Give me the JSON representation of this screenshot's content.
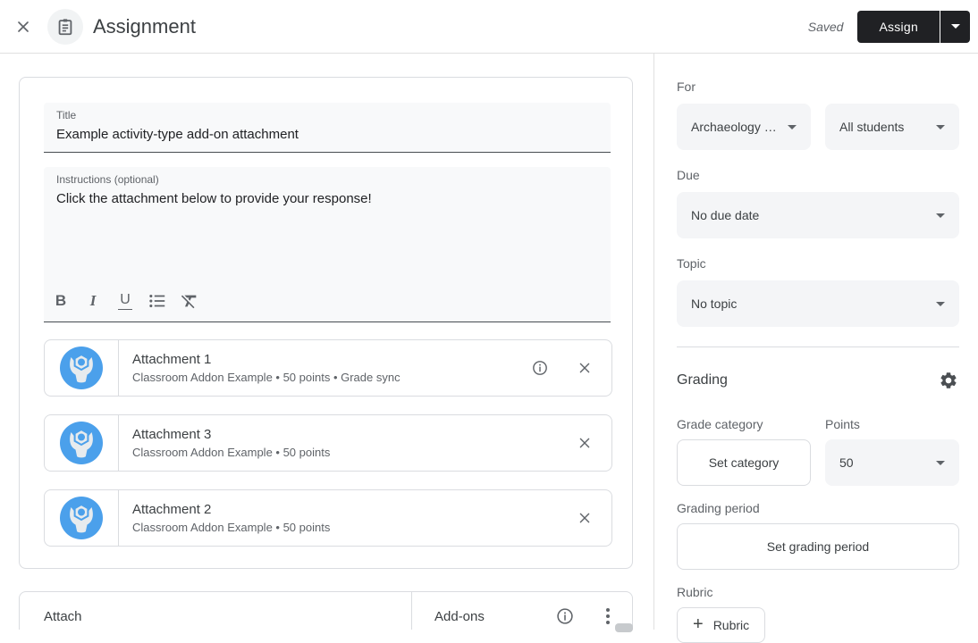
{
  "header": {
    "title": "Assignment",
    "saved_status": "Saved",
    "assign_label": "Assign"
  },
  "editor": {
    "title_label": "Title",
    "title_value": "Example activity-type add-on attachment",
    "instructions_label": "Instructions (optional)",
    "instructions_value": "Click the attachment below to provide your response!",
    "toolbar_icons": [
      "bold",
      "italic",
      "underline",
      "bulleted-list",
      "clear-formatting"
    ],
    "bold_glyph": "B",
    "italic_glyph": "I",
    "underline_glyph": "U"
  },
  "attachments": [
    {
      "title": "Attachment 1",
      "subtitle": "Classroom Addon Example • 50 points • Grade sync"
    },
    {
      "title": "Attachment 3",
      "subtitle": "Classroom Addon Example • 50 points"
    },
    {
      "title": "Attachment 2",
      "subtitle": "Classroom Addon Example • 50 points"
    }
  ],
  "attach_bar": {
    "attach_label": "Attach",
    "addons_label": "Add-ons"
  },
  "sidebar": {
    "for_label": "For",
    "course_value": "Archaeology …",
    "audience_value": "All students",
    "due_label": "Due",
    "due_value": "No due date",
    "topic_label": "Topic",
    "topic_value": "No topic",
    "grading_title": "Grading",
    "grade_category_label": "Grade category",
    "set_category_label": "Set category",
    "points_label": "Points",
    "points_value": "50",
    "grading_period_label": "Grading period",
    "set_grading_period_label": "Set grading period",
    "rubric_label": "Rubric",
    "rubric_button_label": "Rubric"
  },
  "colors": {
    "accent_blue": "#4BA0EB",
    "assign_button": "#202124",
    "text_primary": "#3c4043",
    "text_secondary": "#5f6368",
    "border": "#dadce0"
  }
}
